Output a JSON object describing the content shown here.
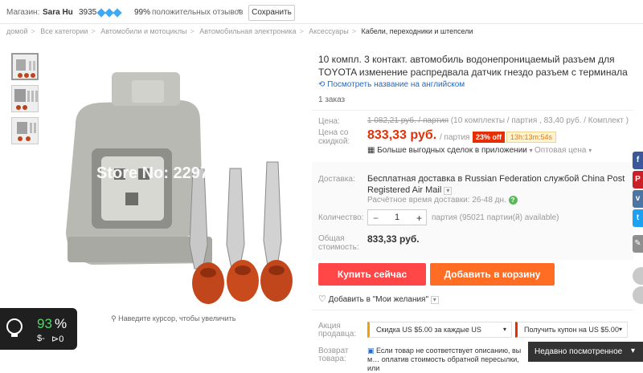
{
  "store": {
    "label": "Магазин:",
    "name": "Sara Hu",
    "score": "3935",
    "positive": "99%",
    "positive_text": "положительных отзывов",
    "save": "Сохранить"
  },
  "breadcrumbs": [
    "домой",
    "Все категории",
    "Автомобили и мотоциклы",
    "Автомобильная электроника",
    "Аксессуары",
    "Кабели, переходники и штепсели"
  ],
  "gallery": {
    "watermark": "Store No: 229762",
    "hint": "Наведите курсор, чтобы увеличить"
  },
  "widget": {
    "percent": "93",
    "percent_sign": "%",
    "money": "$-",
    "arrows": "⊳0"
  },
  "product": {
    "title": "10 компл. 3 контакт. автомобиль водонепроницаемый разъем для TOYOTA изменение распредвала датчик гнездо разъем с терминала",
    "english_link": "Посмотреть название на английском",
    "orders": "1 заказ"
  },
  "price": {
    "price_label": "Цена:",
    "old_price": "1 082,21 руб. / партия",
    "old_detail": "(10 комплекты / партия , 83,40 руб. / Комплект )",
    "discount_label_1": "Цена со",
    "discount_label_2": "скидкой:",
    "current": "833,33 руб.",
    "per_lot": "/ партия",
    "off": "23% off",
    "timer": "13h:13m:54s",
    "app_deals": "Больше выгодных сделок в приложении",
    "wholesale": "Оптовая цена"
  },
  "delivery": {
    "label": "Доставка:",
    "text": "Бесплатная доставка в Russian Federation службой China Post Registered Air Mail",
    "time": "Расчётное время доставки: 26-48 дн."
  },
  "quantity": {
    "label": "Количество:",
    "minus": "−",
    "value": "1",
    "plus": "+",
    "available": "партия (95021 партии(й) available)"
  },
  "total": {
    "label_1": "Общая",
    "label_2": "стоимость:",
    "value": "833,33 руб."
  },
  "actions": {
    "buy": "Купить сейчас",
    "cart": "Добавить в корзину",
    "wishlist": "Добавить в \"Мои желания\""
  },
  "promo": {
    "label_1": "Акция",
    "label_2": "продавца:",
    "coupon1": "Скидка US $5.00 за каждые US",
    "coupon2": "Получить купон на US $5.00"
  },
  "returns": {
    "label_1": "Возврат",
    "label_2": "товара:",
    "text": "Если товар не соответствует описанию, вы м… оплатив стоимость обратной пересылки, или"
  },
  "recently_viewed": "Недавно посмотренное",
  "colors": {
    "accent_red": "#e62e04",
    "buy_button": "#ff4747",
    "cart_button": "#ff6c23",
    "link_blue": "#2469c2"
  }
}
